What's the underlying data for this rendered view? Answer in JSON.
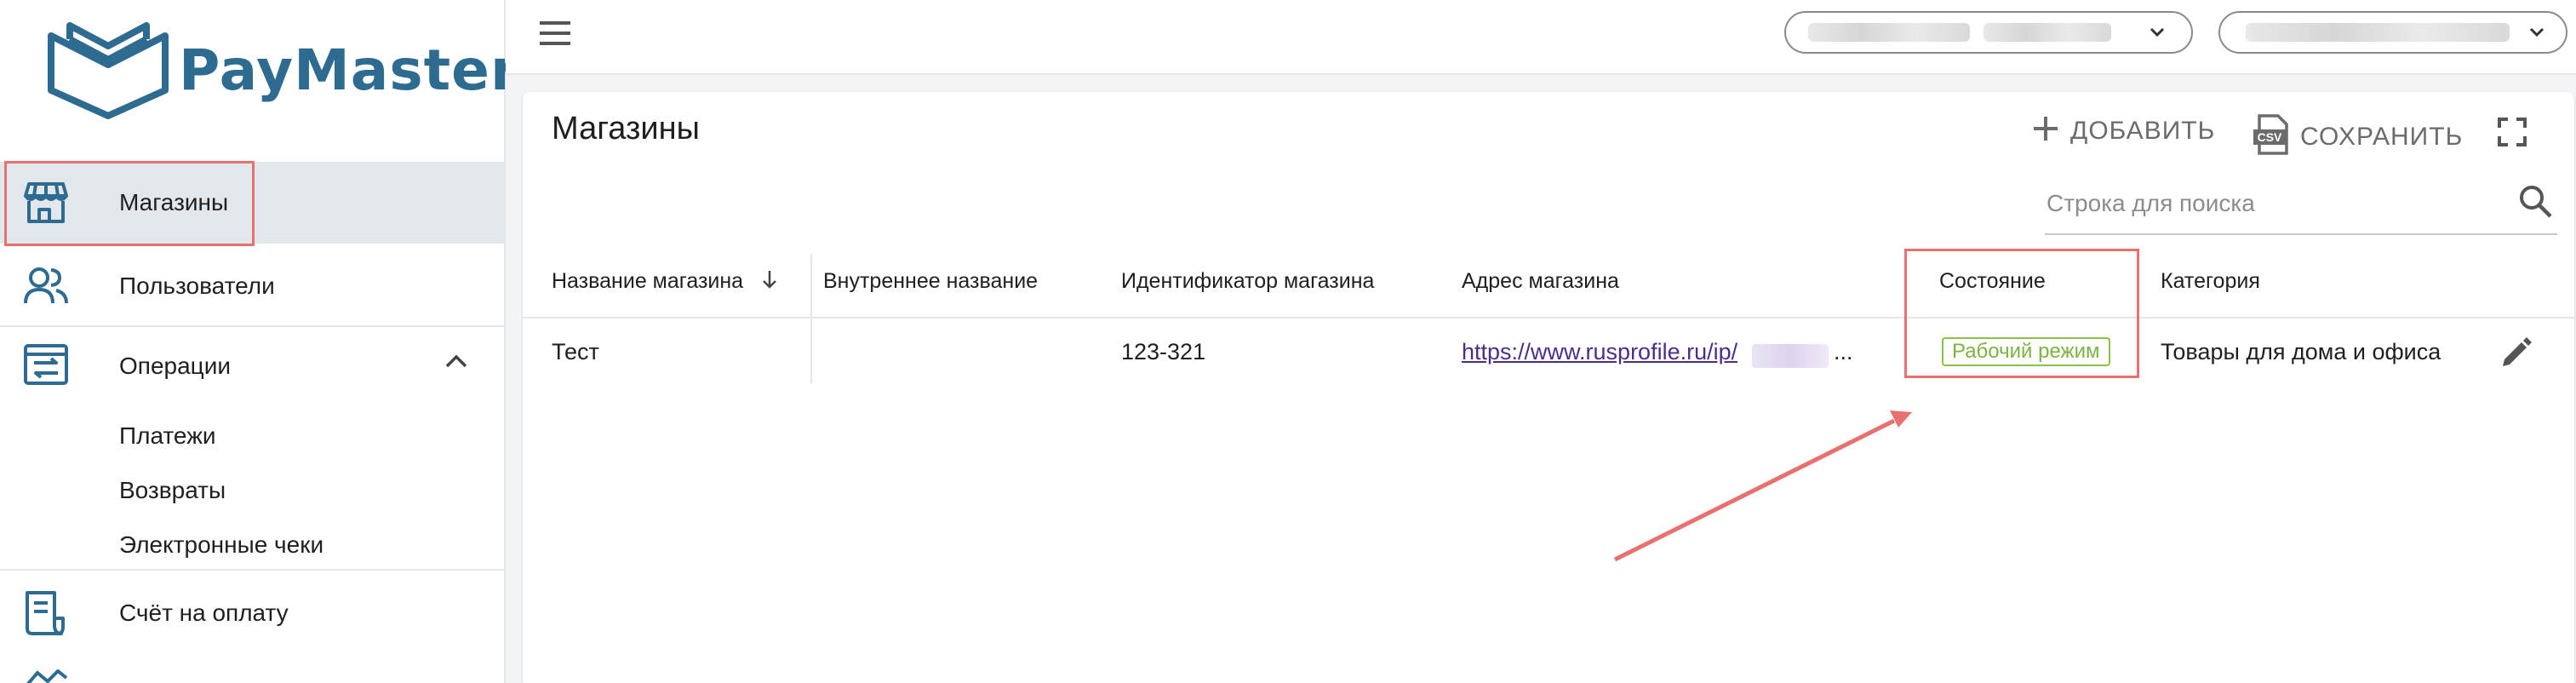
{
  "brand": {
    "name": "PayMaster",
    "color": "#2d6b91",
    "logo_icon": "book-logo-icon"
  },
  "sidebar": {
    "items": [
      {
        "label": "Магазины",
        "icon": "store-icon",
        "active": true
      },
      {
        "label": "Пользователи",
        "icon": "users-icon"
      },
      {
        "label": "Операции",
        "icon": "transfer-icon",
        "expanded": true,
        "children": [
          {
            "label": "Платежи"
          },
          {
            "label": "Возвраты"
          },
          {
            "label": "Электронные чеки"
          }
        ]
      },
      {
        "label": "Счёт на оплату",
        "icon": "invoice-icon"
      }
    ]
  },
  "topbar": {
    "menu_icon": "hamburger-icon",
    "selects": [
      {
        "icon": "chevron-down-icon"
      },
      {
        "icon": "chevron-down-icon"
      }
    ]
  },
  "page": {
    "title": "Магазины",
    "actions": {
      "add_label": "ДОБАВИТЬ",
      "save_label": "СОХРАНИТЬ",
      "csv_text": "CSV"
    },
    "search": {
      "placeholder": "Строка для поиска"
    },
    "table": {
      "columns": [
        "Название магазина",
        "Внутреннее название",
        "Идентификатор магазина",
        "Адрес магазина",
        "Состояние",
        "Категория"
      ],
      "sort_icon": "arrow-down-icon",
      "rows": [
        {
          "name": "Тест",
          "internal_name": "",
          "id": "123-321",
          "address": "https://www.rusprofile.ru/ip/",
          "address_ellipsis": "...",
          "status": "Рабочий режим",
          "category": "Товары для дома и офиса"
        }
      ]
    }
  },
  "colors": {
    "accent_highlight": "#e8716f",
    "status_green": "#7cb342",
    "active_bg": "#e2e7eb",
    "link": "#4b2e8a"
  }
}
